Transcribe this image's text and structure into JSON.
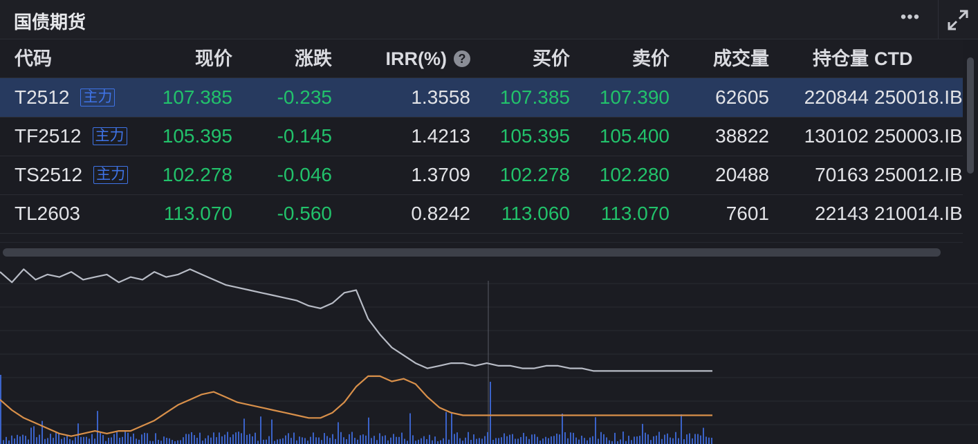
{
  "header": {
    "title": "国债期货",
    "more_icon": "ellipsis-icon",
    "expand_icon": "expand-icon"
  },
  "table": {
    "columns": {
      "code": "代码",
      "price": "现价",
      "change": "涨跌",
      "irr": "IRR(%)",
      "irr_help": "?",
      "bid": "买价",
      "ask": "卖价",
      "volume": "成交量",
      "open_interest": "持仓量",
      "ctd": "CTD"
    },
    "rows": [
      {
        "code": "T2512",
        "tag": "主力",
        "price": "107.385",
        "change": "-0.235",
        "irr": "1.3558",
        "bid": "107.385",
        "ask": "107.390",
        "volume": "62605",
        "open_interest": "220844",
        "ctd": "250018.IB"
      },
      {
        "code": "TF2512",
        "tag": "主力",
        "price": "105.395",
        "change": "-0.145",
        "irr": "1.4213",
        "bid": "105.395",
        "ask": "105.400",
        "volume": "38822",
        "open_interest": "130102",
        "ctd": "250003.IB"
      },
      {
        "code": "TS2512",
        "tag": "主力",
        "price": "102.278",
        "change": "-0.046",
        "irr": "1.3709",
        "bid": "102.278",
        "ask": "102.280",
        "volume": "20488",
        "open_interest": "70163",
        "ctd": "250012.IB"
      },
      {
        "code": "TL2603",
        "tag": "",
        "price": "113.070",
        "change": "-0.560",
        "irr": "0.8242",
        "bid": "113.060",
        "ask": "113.070",
        "volume": "7601",
        "open_interest": "22143",
        "ctd": "210014.IB"
      }
    ],
    "selected_row": 0
  },
  "colors": {
    "background": "#1b1c22",
    "selected_row": "#273a5f",
    "price_green": "#22c26b",
    "tag_blue": "#3f74e8",
    "price_line": "#b8bcc6",
    "avg_line": "#d9904a",
    "volume_bar": "#3b63c9"
  },
  "chart_data": {
    "type": "line",
    "x": [
      0,
      4,
      8,
      12,
      16,
      20,
      24,
      28,
      32,
      36,
      40,
      44,
      48,
      52,
      56,
      60,
      64,
      68,
      72,
      76,
      80,
      84,
      88,
      92,
      96,
      100,
      104,
      108,
      112,
      116,
      120,
      124,
      128,
      132,
      136,
      140,
      144,
      148,
      152,
      156,
      160,
      164,
      168,
      172,
      176,
      180,
      184,
      188,
      192,
      196,
      200,
      204,
      208,
      212,
      216,
      220,
      224,
      228,
      232,
      236,
      240
    ],
    "series": [
      {
        "values": [
          98.6,
          98.2,
          98.7,
          98.3,
          98.5,
          98.4,
          98.6,
          98.3,
          98.4,
          98.5,
          98.2,
          98.4,
          98.3,
          98.6,
          98.4,
          98.5,
          98.7,
          98.5,
          98.3,
          98.1,
          98.0,
          97.9,
          97.8,
          97.7,
          97.6,
          97.5,
          97.3,
          97.2,
          97.4,
          97.8,
          97.9,
          96.8,
          96.2,
          95.7,
          95.4,
          95.1,
          94.9,
          95.0,
          95.1,
          95.1,
          95.0,
          95.1,
          95.0,
          95.0,
          94.9,
          94.9,
          95.0,
          95.0,
          94.9,
          94.9,
          94.8,
          94.8,
          94.8,
          94.8,
          94.8,
          94.8,
          94.8,
          94.8,
          94.8,
          94.8,
          94.8
        ]
      },
      {
        "values": [
          93.7,
          93.3,
          93.0,
          92.8,
          92.6,
          92.4,
          92.3,
          92.4,
          92.5,
          92.4,
          92.5,
          92.5,
          92.7,
          92.9,
          93.2,
          93.5,
          93.7,
          93.9,
          94.0,
          93.8,
          93.6,
          93.5,
          93.4,
          93.3,
          93.2,
          93.1,
          93.0,
          93.0,
          93.2,
          93.6,
          94.2,
          94.6,
          94.6,
          94.4,
          94.5,
          94.3,
          93.8,
          93.4,
          93.2,
          93.1,
          93.1,
          93.1,
          93.1,
          93.1,
          93.1,
          93.1,
          93.1,
          93.1,
          93.1,
          93.1,
          93.1,
          93.1,
          93.1,
          93.1,
          93.1,
          93.1,
          93.1,
          93.1,
          93.1,
          93.1,
          93.1
        ]
      }
    ],
    "ylim": [
      92,
      99
    ],
    "grid": true
  }
}
